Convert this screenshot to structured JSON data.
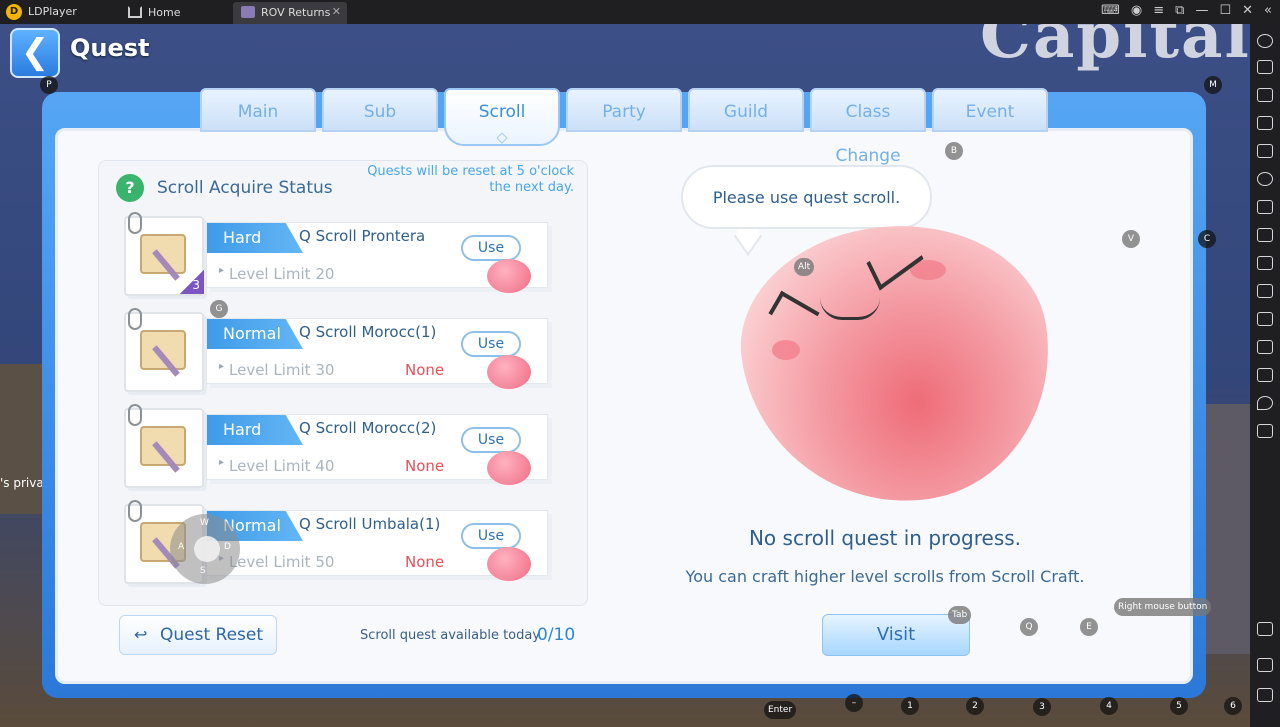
{
  "window": {
    "app_name": "LDPlayer",
    "logo_glyph": "D",
    "tabs": [
      {
        "label": "Home"
      },
      {
        "label": "ROV Returns"
      }
    ],
    "close_glyph": "✕"
  },
  "background": {
    "sign_text": "Capital",
    "chat_text": "'s privat"
  },
  "header": {
    "back_glyph": "❮",
    "title": "Quest"
  },
  "tabs": [
    {
      "label": "Main"
    },
    {
      "label": "Sub"
    },
    {
      "label": "Scroll",
      "active": true
    },
    {
      "label": "Party"
    },
    {
      "label": "Guild"
    },
    {
      "label": "Class Change"
    },
    {
      "label": "Event"
    }
  ],
  "status": {
    "icon_glyph": "?",
    "title": "Scroll Acquire Status",
    "reset_note": "Quests will be reset at 5 o'clock the next day."
  },
  "scrolls": [
    {
      "difficulty": "Hard",
      "name": "Q Scroll Prontera",
      "level_limit": "Level Limit 20",
      "count": "3",
      "status": "",
      "use_label": "Use"
    },
    {
      "difficulty": "Normal",
      "name": "Q Scroll Morocc(1)",
      "level_limit": "Level Limit 30",
      "count": "",
      "status": "None",
      "use_label": "Use"
    },
    {
      "difficulty": "Hard",
      "name": "Q Scroll Morocc(2)",
      "level_limit": "Level Limit 40",
      "count": "",
      "status": "None",
      "use_label": "Use"
    },
    {
      "difficulty": "Normal",
      "name": "Q Scroll Umbala(1)",
      "level_limit": "Level Limit 50",
      "count": "",
      "status": "None",
      "use_label": "Use"
    }
  ],
  "footer": {
    "reset_icon_glyph": "↩",
    "quest_reset_label": "Quest Reset",
    "available_label": "Scroll quest available today.",
    "available_count": "0/10"
  },
  "npc": {
    "speech": "Please use quest scroll.",
    "no_quest": "No scroll quest in progress.",
    "craft_hint": "You can craft higher level scrolls from Scroll Craft.",
    "visit_label": "Visit"
  },
  "key_hints": {
    "p": "P",
    "m": "M",
    "b": "B",
    "v": "V",
    "c": "C",
    "alt": "Alt",
    "g": "G",
    "tab": "Tab",
    "q": "Q",
    "e": "E",
    "right_mouse": "Right mouse button",
    "enter": "Enter",
    "minus": "–",
    "n1": "1",
    "n2": "2",
    "n3": "3",
    "n4": "4",
    "n5": "5",
    "n6": "6",
    "w": "W",
    "a": "A",
    "s": "S",
    "d": "D"
  },
  "colors": {
    "accent_blue": "#3a8fe0",
    "none_red": "#ec4e58",
    "hard_badge": "#3f9be8"
  }
}
